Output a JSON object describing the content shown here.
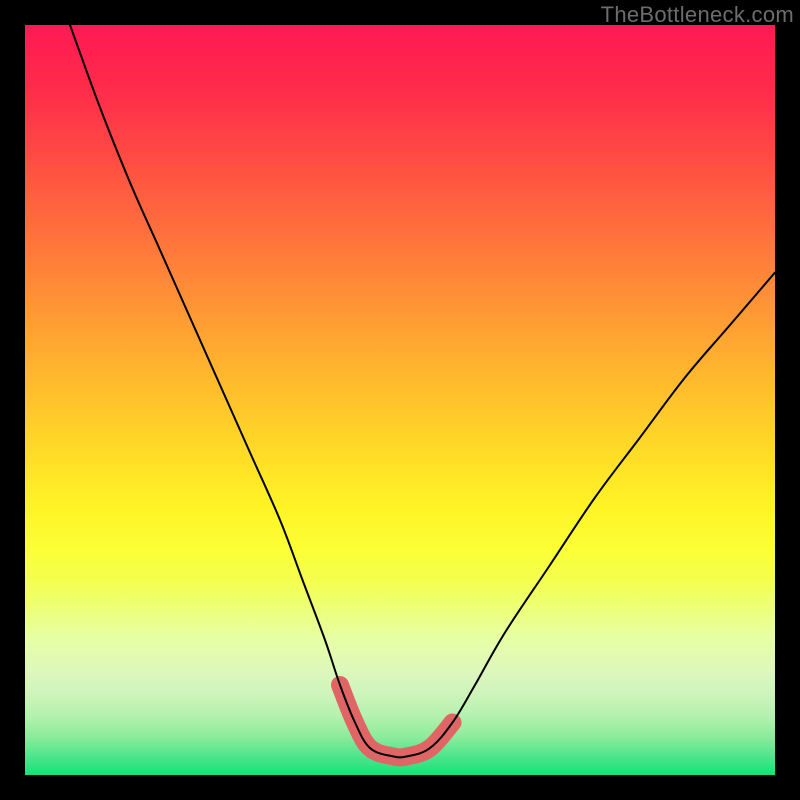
{
  "watermark": "TheBottleneck.com",
  "chart_data": {
    "type": "line",
    "title": "",
    "xlabel": "",
    "ylabel": "",
    "x_range": [
      0,
      100
    ],
    "y_range": [
      0,
      100
    ],
    "background_gradient": {
      "top_color": "#ff1a55",
      "bottom_color": "#16e276",
      "direction": "vertical"
    },
    "series": [
      {
        "name": "bottleneck-curve",
        "color": "#000000",
        "stroke_width": 2,
        "x": [
          6,
          10,
          14,
          18,
          22,
          26,
          30,
          34,
          37,
          40,
          42,
          44,
          46,
          49,
          51,
          54,
          57,
          60,
          64,
          70,
          76,
          82,
          88,
          94,
          100
        ],
        "values": [
          100,
          89,
          79,
          70,
          61,
          52,
          43,
          34,
          26,
          18,
          12,
          7,
          3.6,
          2.5,
          2.5,
          3.6,
          7,
          12,
          19,
          28,
          37,
          45,
          53,
          60,
          67
        ]
      },
      {
        "name": "optimal-zone-highlight",
        "color": "#e06666",
        "stroke_width": 18,
        "shape": "rounded",
        "x": [
          42,
          44,
          46,
          49,
          51,
          54,
          57
        ],
        "values": [
          12,
          7,
          3.6,
          2.5,
          2.5,
          3.6,
          7
        ]
      }
    ],
    "annotations": []
  }
}
